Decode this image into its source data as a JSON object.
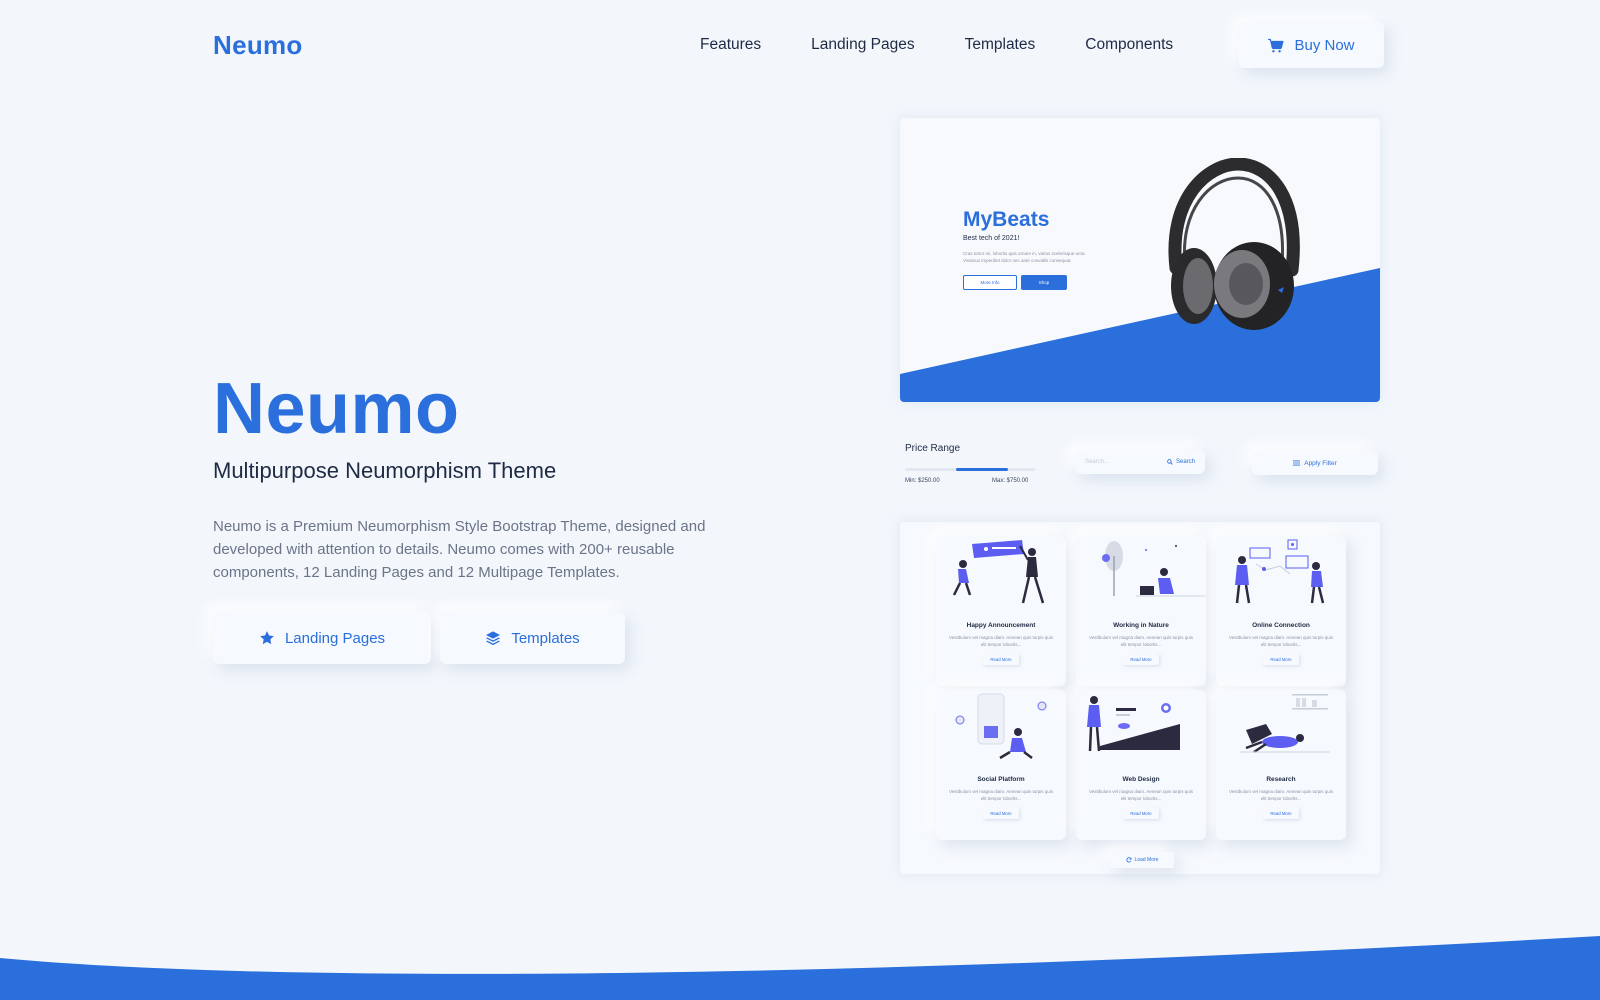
{
  "brand": "Neumo",
  "nav": {
    "items": [
      "Features",
      "Landing Pages",
      "Templates",
      "Components"
    ],
    "buy_label": "Buy Now"
  },
  "hero": {
    "title": "Neumo",
    "subtitle": "Multipurpose Neumorphism Theme",
    "description": "Neumo is a Premium Neumorphism Style Bootstrap Theme, designed and developed with attention to details. Neumo comes with 200+ reusable components, 12 Landing Pages and 12 Multipage Templates.",
    "btn_landing": "Landing Pages",
    "btn_templates": "Templates"
  },
  "showcase": {
    "product": {
      "title": "MyBeats",
      "subtitle": "Best tech of 2021!",
      "desc": "Cras tortor mi, lobortis quis ornare in, varius scelerisque urna. Vivamus imperdiet dolor nec ante convallis consequat.",
      "more_info": "More Info",
      "shop": "Shop"
    },
    "filters": {
      "price_label": "Price Range",
      "min_label": "Min: $250.00",
      "max_label": "Max: $750.00",
      "range_fraction": [
        0.39,
        0.79
      ],
      "search_placeholder": "Search...",
      "search_button": "Search",
      "apply_filter": "Apply Filter"
    },
    "cards": [
      {
        "title": "Happy Announcement",
        "desc": "Vestibulum vel magna diam. Aenean quis turpis quis elit tempor lobortis...",
        "cta": "Read More",
        "illustration": "announcement"
      },
      {
        "title": "Working in Nature",
        "desc": "Vestibulum vel magna diam. Aenean quis turpis quis elit tempor lobortis...",
        "cta": "Read More",
        "illustration": "nature"
      },
      {
        "title": "Online Connection",
        "desc": "Vestibulum vel magna diam. Aenean quis turpis quis elit tempor lobortis...",
        "cta": "Read More",
        "illustration": "connection"
      },
      {
        "title": "Social Platform",
        "desc": "Vestibulum vel magna diam. Aenean quis turpis quis elit tempor lobortis...",
        "cta": "Read More",
        "illustration": "social"
      },
      {
        "title": "Web Design",
        "desc": "Vestibulum vel magna diam. Aenean quis turpis quis elit tempor lobortis...",
        "cta": "Read More",
        "illustration": "webdesign"
      },
      {
        "title": "Research",
        "desc": "Vestibulum vel magna diam. Aenean quis turpis quis elit tempor lobortis...",
        "cta": "Read More",
        "illustration": "research"
      }
    ],
    "load_more": "Load More"
  },
  "colors": {
    "accent": "#2a6fdb",
    "background": "#f3f7fc",
    "text": "#1f2a44",
    "muted": "#6b7488"
  }
}
